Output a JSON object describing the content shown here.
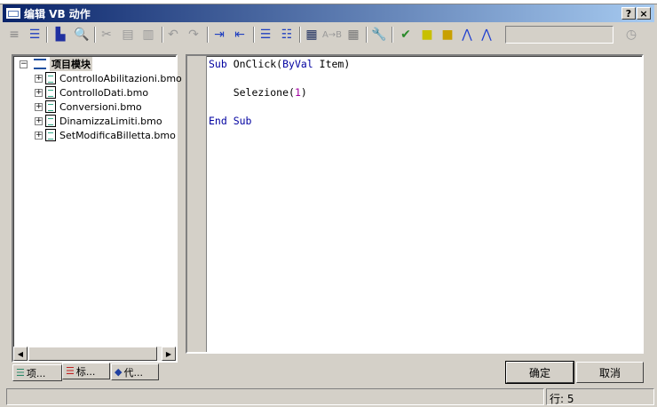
{
  "window": {
    "title": "编辑 VB 动作",
    "help_label": "?",
    "close_label": "×"
  },
  "toolbar": {
    "icons": [
      "grip-icon",
      "toggle-panel-icon",
      "print-icon",
      "print-preview-icon",
      "cut-icon",
      "copy-icon",
      "paste-icon",
      "undo-icon",
      "redo-icon",
      "indent-icon",
      "outdent-icon",
      "comment-icon",
      "uncomment-icon",
      "find-icon",
      "replace-icon",
      "find-next-icon",
      "wrench-icon",
      "check-syntax-icon",
      "object-icon",
      "object-add-icon",
      "compass-object-icon",
      "compass-icon",
      "clock-icon"
    ],
    "search_value": ""
  },
  "tree": {
    "root": "项目模块",
    "items": [
      "ControlloAbilitazioni.bmo",
      "ControlloDati.bmo",
      "Conversioni.bmo",
      "DinamizzaLimiti.bmo",
      "SetModificaBilletta.bmo"
    ]
  },
  "tabs": [
    "项...",
    "标...",
    "代..."
  ],
  "code": {
    "l1_kw1": "Sub",
    "l1_a": " OnClick(",
    "l1_kw2": "ByVal",
    "l1_b": " Item)",
    "l3_a": "    Selezione(",
    "l3_num": "1",
    "l3_b": ")",
    "l5_kw1": "End",
    "l5_kw2": " Sub"
  },
  "buttons": {
    "ok": "确定",
    "cancel": "取消"
  },
  "status": {
    "line": "行: 5"
  }
}
